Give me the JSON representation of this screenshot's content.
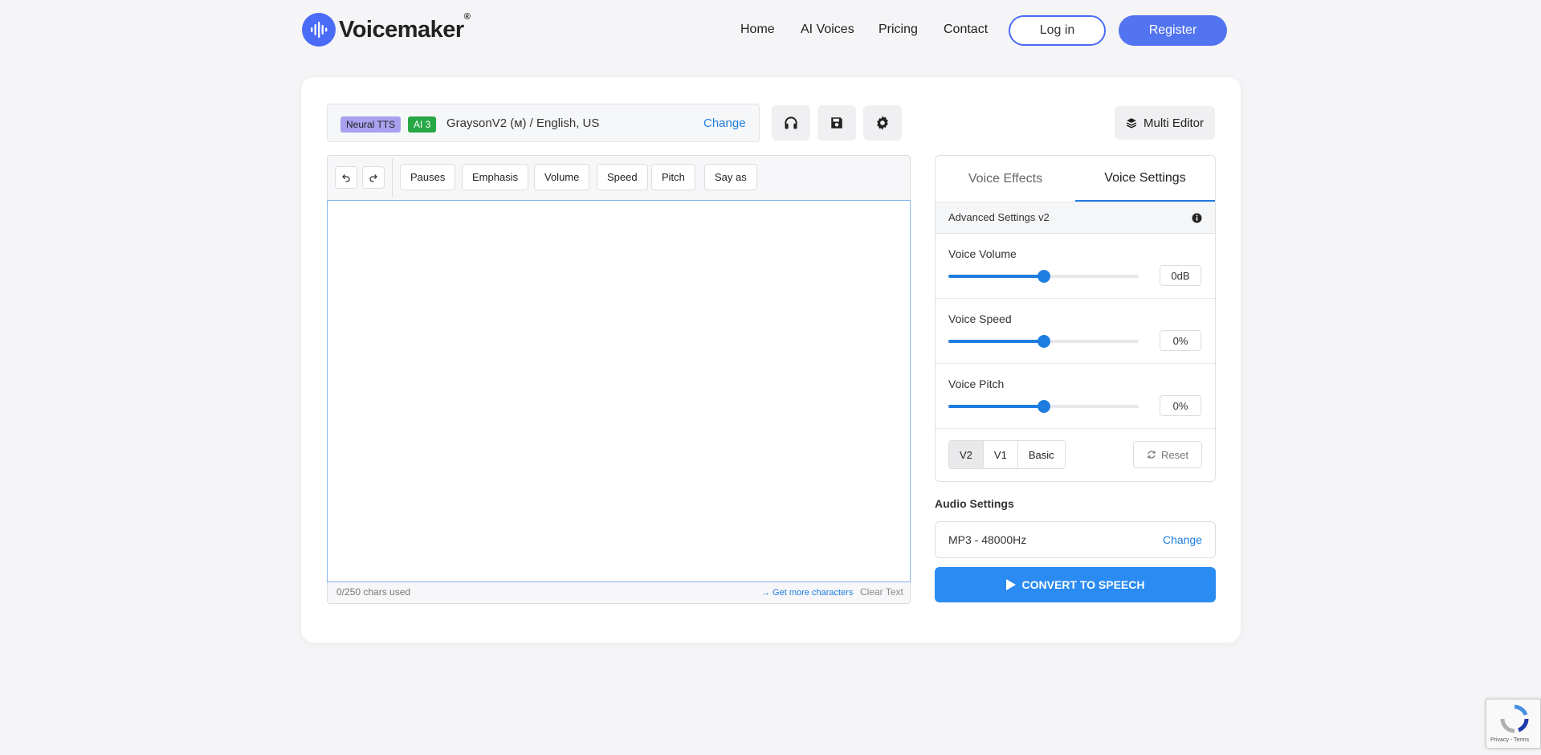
{
  "header": {
    "brand": "Voicemaker",
    "brand_mark": "®",
    "nav": [
      "Home",
      "AI Voices",
      "Pricing",
      "Contact"
    ],
    "login_label": "Log in",
    "register_label": "Register"
  },
  "voice": {
    "engine_badge": "Neural TTS",
    "ai_badge": "AI 3",
    "name": "GraysonV2 (ᴍ) / English, US",
    "change_label": "Change"
  },
  "top_actions": {
    "icons": [
      "headphones-icon",
      "save-icon",
      "gear-icon"
    ],
    "multi_editor_label": "Multi Editor"
  },
  "editor": {
    "toolbar": [
      "Pauses",
      "Emphasis",
      "Volume",
      "Speed",
      "Pitch",
      "Say as"
    ],
    "text": "",
    "chars_used": "0/250 chars used",
    "more_chars_label": "→ Get more characters",
    "clear_label": "Clear Text"
  },
  "settings": {
    "tabs": [
      "Voice Effects",
      "Voice Settings"
    ],
    "active_tab": "Voice Settings",
    "advanced_label": "Advanced Settings v2",
    "sliders": [
      {
        "label": "Voice Volume",
        "value": "0dB",
        "level": 0.5
      },
      {
        "label": "Voice Speed",
        "value": "0%",
        "level": 0.5
      },
      {
        "label": "Voice Pitch",
        "value": "0%",
        "level": 0.5
      }
    ],
    "versions": [
      "V2",
      "V1",
      "Basic"
    ],
    "active_version": "V2",
    "reset_label": "Reset"
  },
  "audio": {
    "label": "Audio Settings",
    "value": "MP3 - 48000Hz",
    "change_label": "Change"
  },
  "convert_label": "CONVERT TO SPEECH",
  "recaptcha_text": "Privacy - Terms",
  "colors": {
    "accent": "#1e7de0",
    "brand": "#4a6cf7",
    "convert": "#2a8bf2",
    "neural_badge": "#a9a0f0",
    "ai_badge": "#28a745"
  }
}
